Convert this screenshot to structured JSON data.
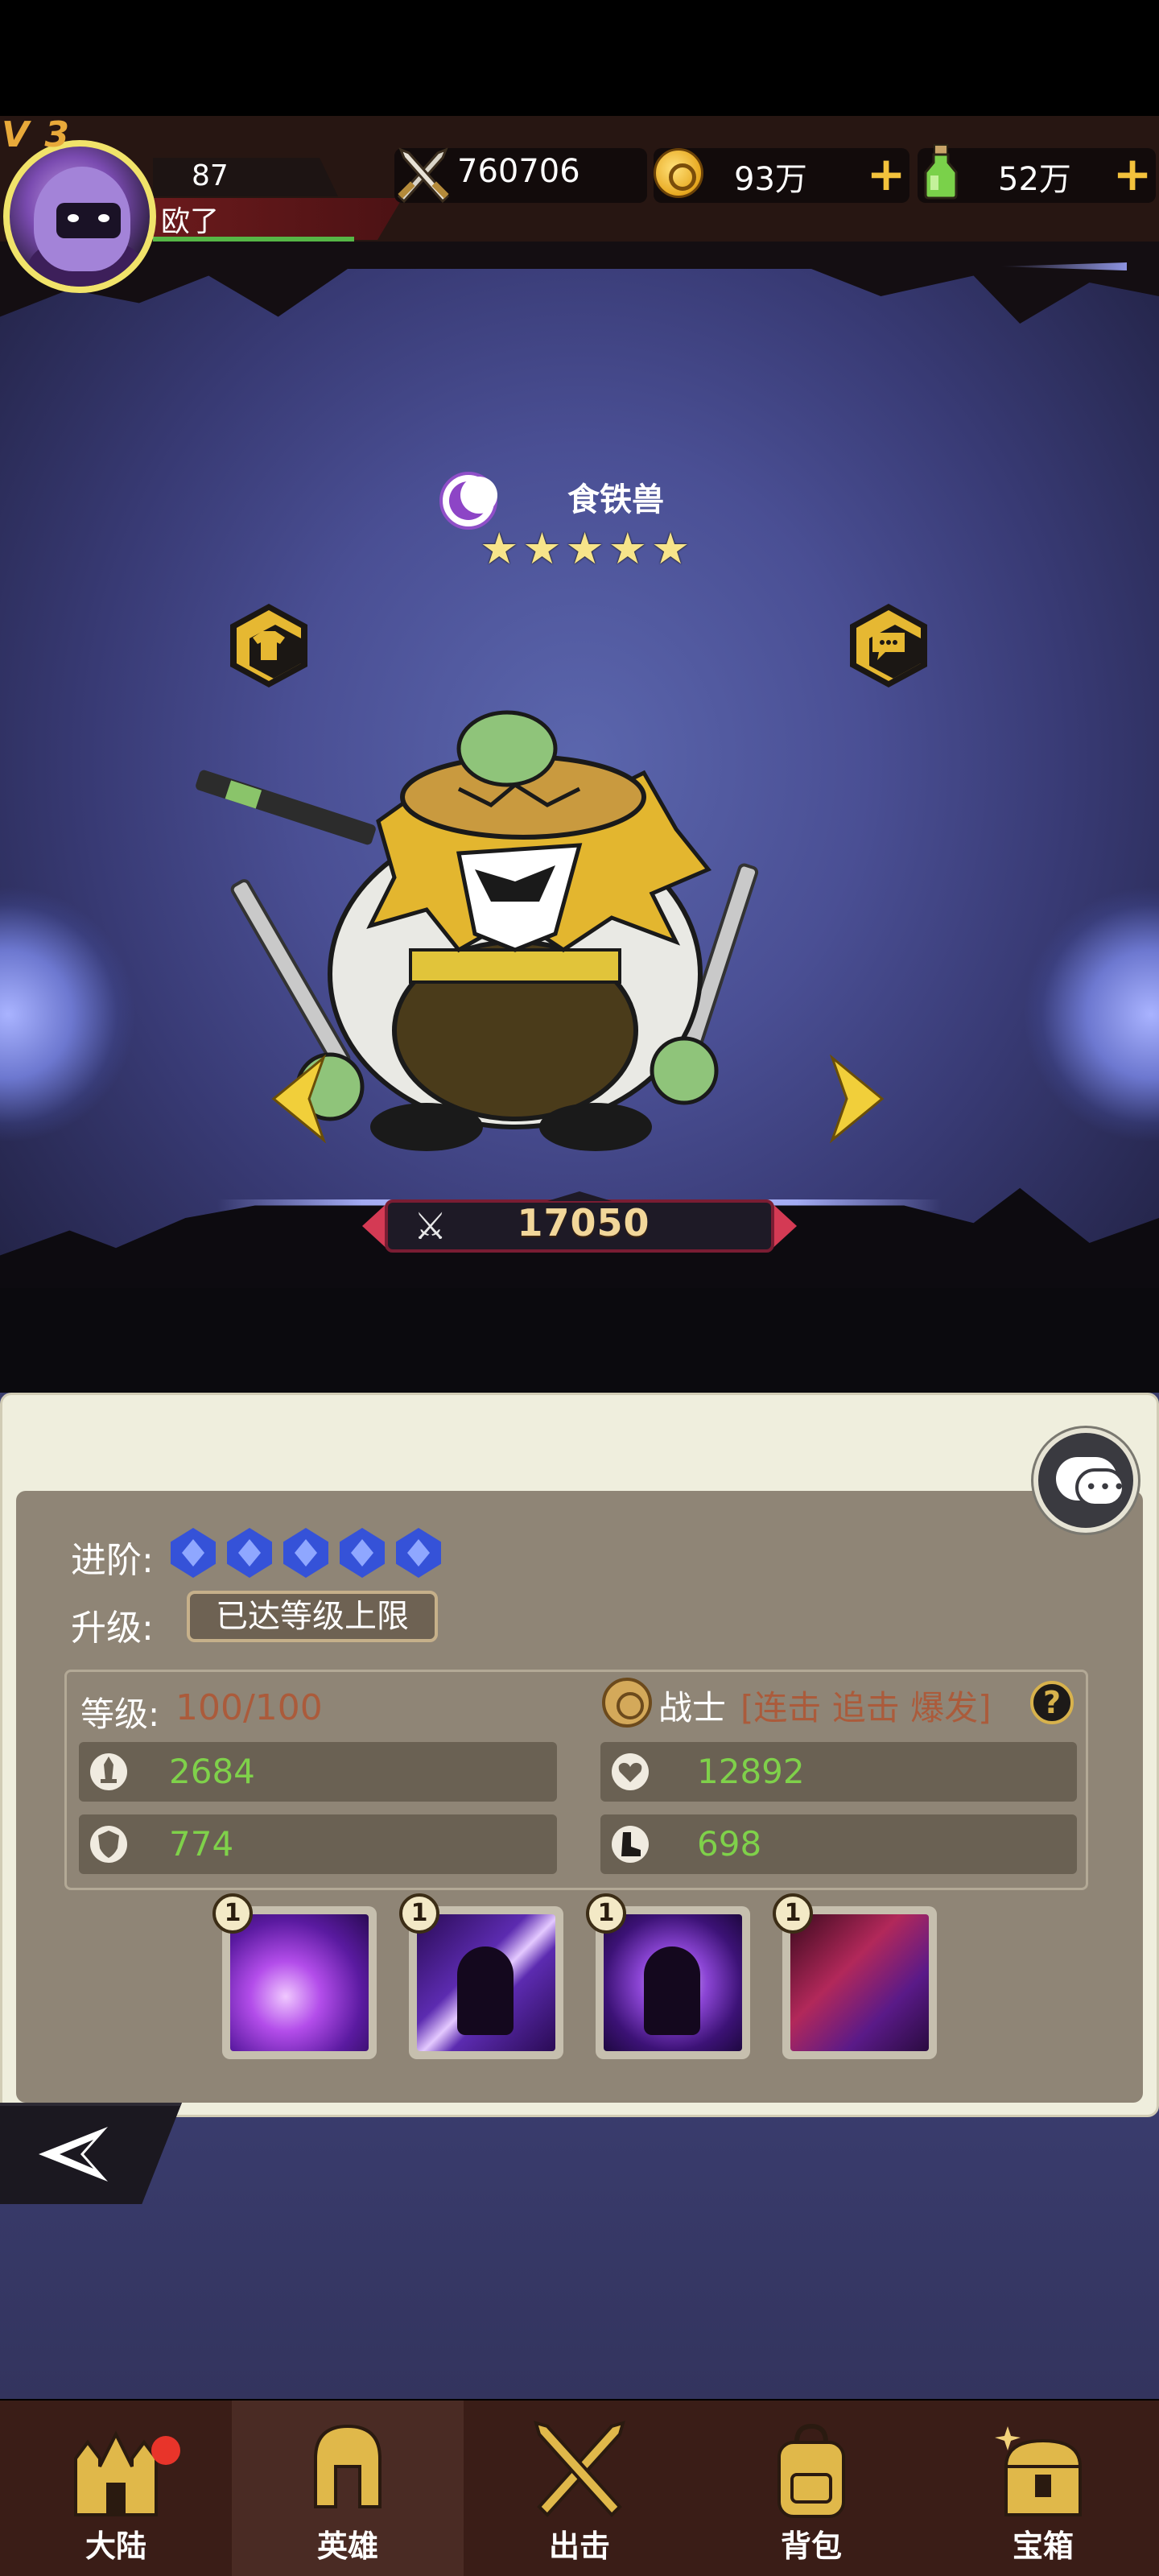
{
  "player": {
    "vip_tag": "V 3",
    "level": "87",
    "name": "欧了"
  },
  "resources": {
    "power": "760706",
    "gold": "93万",
    "potion": "52万",
    "plus_symbol": "+"
  },
  "hero": {
    "name": "食铁兽",
    "stars_count": 5,
    "star_glyph": "★",
    "combat_power": "17050",
    "costume_icon": "shirt-icon",
    "dialog_icon": "speech-bubble-icon"
  },
  "details": {
    "advance_label": "进阶:",
    "advance_gems": 5,
    "upgrade_label": "升级:",
    "upgrade_status": "已达等级上限",
    "level_label": "等级:",
    "level_value": "100/100",
    "class_name": "战士",
    "class_tags": "[连击 追击 爆发]",
    "help_symbol": "?"
  },
  "stats": {
    "attack": "2684",
    "hp": "12892",
    "defense": "774",
    "speed": "698"
  },
  "skills": [
    {
      "level": "1",
      "icon": "purple-slash-skill"
    },
    {
      "level": "1",
      "icon": "shadow-strike-skill"
    },
    {
      "level": "1",
      "icon": "spirit-swirl-skill"
    },
    {
      "level": "1",
      "icon": "blood-claw-skill"
    }
  ],
  "nav": [
    {
      "label": "大陆",
      "icon": "castle-icon",
      "badge": true
    },
    {
      "label": "英雄",
      "icon": "spartan-helmet-icon",
      "active": true
    },
    {
      "label": "出击",
      "icon": "crossed-swords-icon"
    },
    {
      "label": "背包",
      "icon": "backpack-icon"
    },
    {
      "label": "宝箱",
      "icon": "treasure-chest-icon"
    }
  ],
  "colors": {
    "accent_gold": "#e6b832",
    "stat_green": "#7fd14a",
    "level_brown": "#ab5b3b",
    "nav_bg": "#3a1d17"
  }
}
